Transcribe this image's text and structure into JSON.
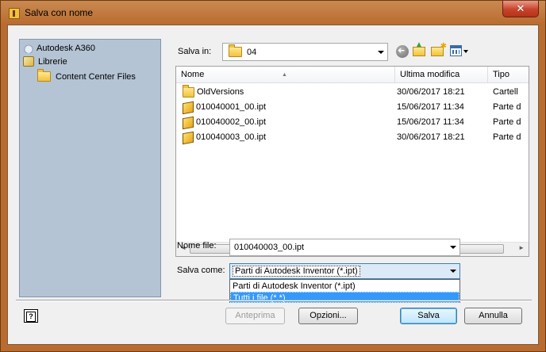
{
  "window": {
    "title": "Salva con nome",
    "close_label": "✕"
  },
  "places": [
    {
      "label": "Autodesk A360",
      "icon": "cloud-icon"
    },
    {
      "label": "Librerie",
      "icon": "library-icon"
    },
    {
      "label": "Content Center Files",
      "icon": "folder-icon"
    }
  ],
  "save_in": {
    "label": "Salva in:",
    "value": "04"
  },
  "toolbar": {
    "icons": [
      "back-icon",
      "up-folder-icon",
      "new-folder-icon",
      "views-menu-icon"
    ]
  },
  "filelist": {
    "columns": [
      "Nome",
      "Ultima modifica",
      "Tipo"
    ],
    "rows": [
      {
        "name": "OldVersions",
        "date": "30/06/2017 18:21",
        "type": "Cartell",
        "icon": "folder-icon"
      },
      {
        "name": "010040001_00.ipt",
        "date": "15/06/2017 11:34",
        "type": "Parte d",
        "icon": "part-icon"
      },
      {
        "name": "010040002_00.ipt",
        "date": "15/06/2017 11:34",
        "type": "Parte d",
        "icon": "part-icon"
      },
      {
        "name": "010040003_00.ipt",
        "date": "30/06/2017 18:21",
        "type": "Parte d",
        "icon": "part-icon"
      }
    ],
    "scroll_left": "◄",
    "scroll_right": "►"
  },
  "filename": {
    "label": "Nome file:",
    "value": "010040003_00.ipt"
  },
  "save_as": {
    "label": "Salva come:",
    "value": "Parti di Autodesk Inventor (*.ipt)",
    "options": [
      "Parti di Autodesk Inventor (*.ipt)",
      "Tutti i file (*.*)"
    ]
  },
  "buttons": {
    "help": "?",
    "preview": "Anteprima",
    "options": "Opzioni...",
    "save": "Salva",
    "cancel": "Annulla"
  }
}
